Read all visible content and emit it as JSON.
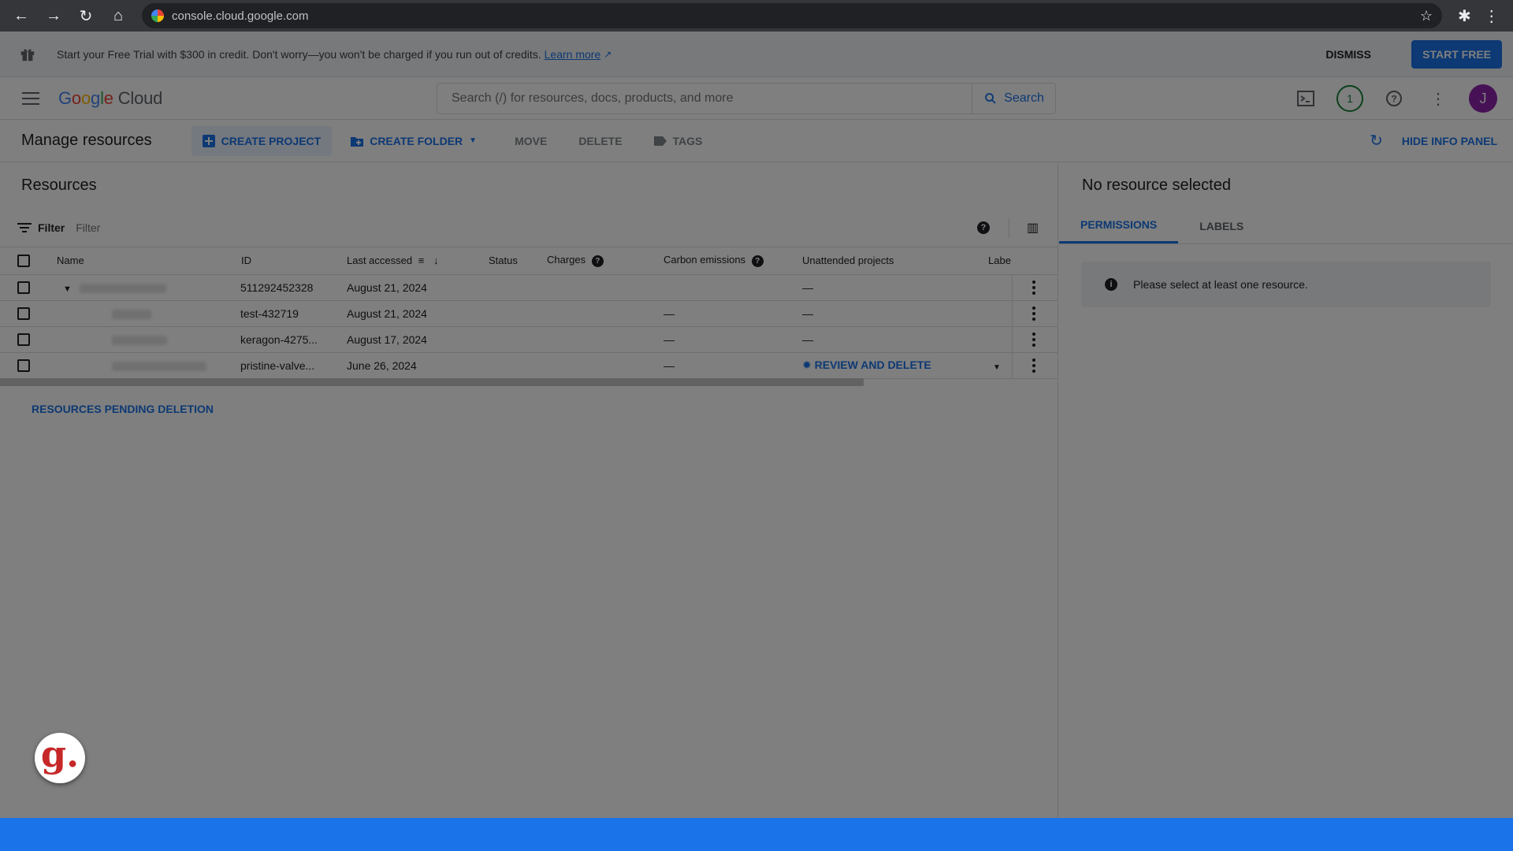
{
  "browser": {
    "url": "console.cloud.google.com"
  },
  "banner": {
    "text": "Start your Free Trial with $300 in credit. Don't worry—you won't be charged if you run out of credits.",
    "learn_more": "Learn more",
    "dismiss": "DISMISS",
    "start_free": "START FREE"
  },
  "header": {
    "logo_google": "Google",
    "logo_cloud": "Cloud",
    "search_placeholder": "Search (/) for resources, docs, products, and more",
    "search_button": "Search",
    "notification_count": "1",
    "avatar_initial": "J"
  },
  "toolbar": {
    "title": "Manage resources",
    "create_project": "CREATE PROJECT",
    "create_folder": "CREATE FOLDER",
    "move": "MOVE",
    "delete": "DELETE",
    "tags": "TAGS",
    "hide_info_panel": "HIDE INFO PANEL"
  },
  "resources": {
    "title": "Resources",
    "filter_label": "Filter",
    "filter_placeholder": "Filter",
    "columns": {
      "name": "Name",
      "id": "ID",
      "last_accessed": "Last accessed",
      "status": "Status",
      "charges": "Charges",
      "carbon": "Carbon emissions",
      "unattended": "Unattended projects",
      "labels": "Labe"
    },
    "rows": [
      {
        "id": "511292452328",
        "last_accessed": "August 21, 2024",
        "carbon": "",
        "unattended": "—"
      },
      {
        "id": "test-432719",
        "last_accessed": "August 21, 2024",
        "carbon": "—",
        "unattended": "—"
      },
      {
        "id": "keragon-4275...",
        "last_accessed": "August 17, 2024",
        "carbon": "—",
        "unattended": "—"
      },
      {
        "id": "pristine-valve...",
        "last_accessed": "June 26, 2024",
        "carbon": "—",
        "unattended": "REVIEW AND DELETE"
      }
    ],
    "pending_deletion": "RESOURCES PENDING DELETION"
  },
  "panel": {
    "title": "No resource selected",
    "tab_permissions": "PERMISSIONS",
    "tab_labels": "LABELS",
    "message": "Please select at least one resource."
  },
  "fab": {
    "letter": "g."
  }
}
